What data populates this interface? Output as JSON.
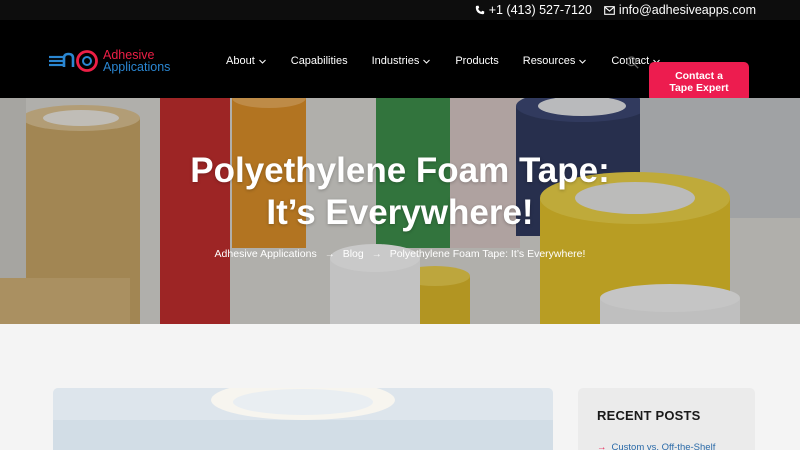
{
  "topbar": {
    "phone": "+1 (413) 527-7120",
    "email": "info@adhesiveapps.com",
    "phone_icon": "phone-icon",
    "email_icon": "envelope-icon"
  },
  "logo": {
    "line1": "Adhesive",
    "line2": "Applications"
  },
  "nav": {
    "items": [
      {
        "label": "About",
        "dropdown": true
      },
      {
        "label": "Capabilities",
        "dropdown": false
      },
      {
        "label": "Industries",
        "dropdown": true
      },
      {
        "label": "Products",
        "dropdown": false
      },
      {
        "label": "Resources",
        "dropdown": true
      },
      {
        "label": "Contact",
        "dropdown": true
      }
    ],
    "search_icon": "search-icon",
    "cta_line1": "Contact a",
    "cta_line2": "Tape Expert"
  },
  "hero": {
    "title_line1": "Polyethylene Foam Tape:",
    "title_line2": "It’s Everywhere!",
    "breadcrumb": [
      "Adhesive Applications",
      "Blog",
      "Polyethylene Foam Tape: It’s Everywhere!"
    ],
    "breadcrumb_sep": "→"
  },
  "sidebar": {
    "heading": "RECENT POSTS",
    "first_post": "Custom vs. Off-the-Shelf"
  },
  "colors": {
    "brand_red": "#ed1c4f",
    "brand_blue": "#2a86d1",
    "header_bg": "#000000"
  }
}
